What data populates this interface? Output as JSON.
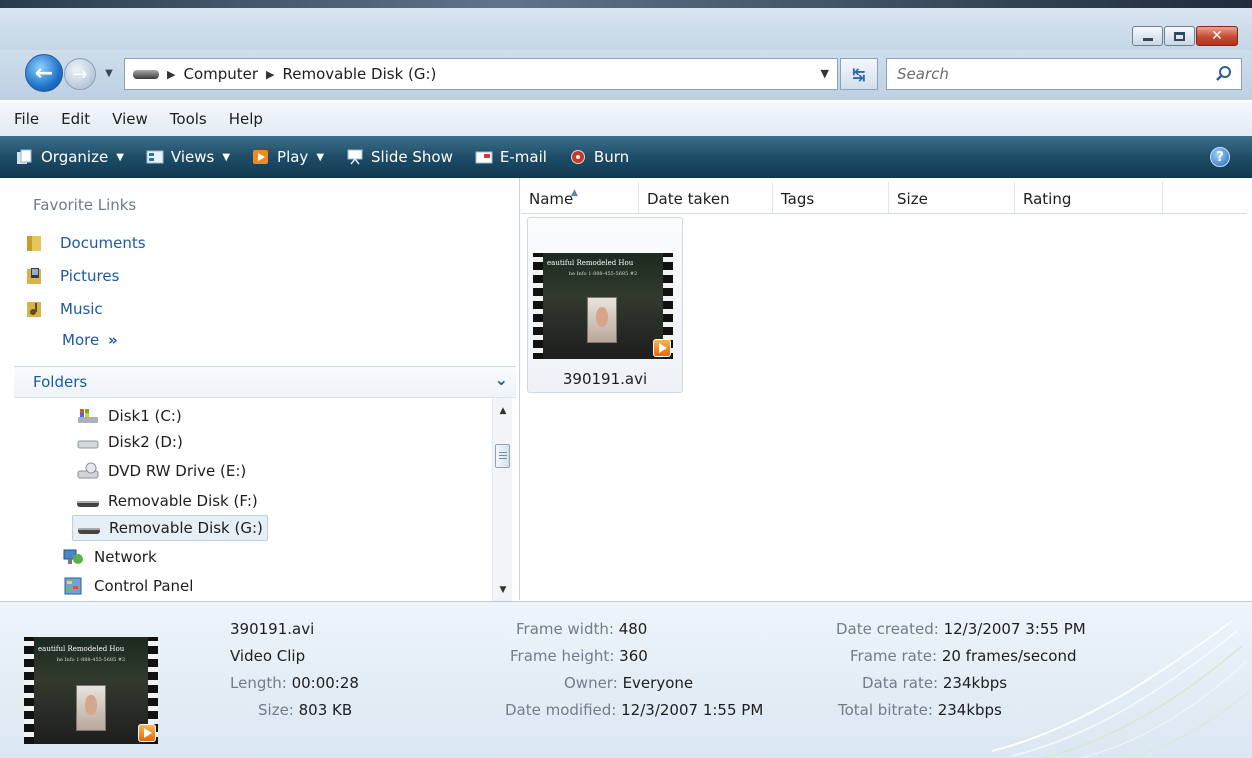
{
  "address": {
    "crumbs": [
      "Computer",
      "Removable Disk (G:)"
    ]
  },
  "search": {
    "placeholder": "Search"
  },
  "menu": [
    "File",
    "Edit",
    "View",
    "Tools",
    "Help"
  ],
  "toolbar": {
    "organize": "Organize",
    "views": "Views",
    "play": "Play",
    "slideshow": "Slide Show",
    "email": "E-mail",
    "burn": "Burn"
  },
  "favorites": {
    "label": "Favorite Links",
    "items": [
      "Documents",
      "Pictures",
      "Music"
    ],
    "more": "More"
  },
  "folders": {
    "label": "Folders",
    "items": [
      "Disk1 (C:)",
      "Disk2 (D:)",
      "DVD RW Drive (E:)",
      "Removable Disk (F:)",
      "Removable Disk (G:)",
      "Network",
      "Control Panel"
    ],
    "selected_index": 4
  },
  "columns": [
    "Name",
    "Date taken",
    "Tags",
    "Size",
    "Rating"
  ],
  "file": {
    "name": "390191.avi",
    "thumb_title": "eautiful Remodeled Hou",
    "thumb_sub": "he Info 1-888-455-5685 #2"
  },
  "details": {
    "name": "390191.avi",
    "type": "Video Clip",
    "length_label": "Length:",
    "length": "00:00:28",
    "size_label": "Size:",
    "size": "803 KB",
    "frame_width_label": "Frame width:",
    "frame_width": "480",
    "frame_height_label": "Frame height:",
    "frame_height": "360",
    "owner_label": "Owner:",
    "owner": "Everyone",
    "date_modified_label": "Date modified:",
    "date_modified": "12/3/2007 1:55 PM",
    "date_created_label": "Date created:",
    "date_created": "12/3/2007 3:55 PM",
    "frame_rate_label": "Frame rate:",
    "frame_rate": "20 frames/second",
    "data_rate_label": "Data rate:",
    "data_rate": "234kbps",
    "total_bitrate_label": "Total bitrate:",
    "total_bitrate": "234kbps"
  },
  "colors": {
    "toolbar": "#1e4c67",
    "link": "#1c5aa6",
    "label_gray": "#707d8a"
  }
}
